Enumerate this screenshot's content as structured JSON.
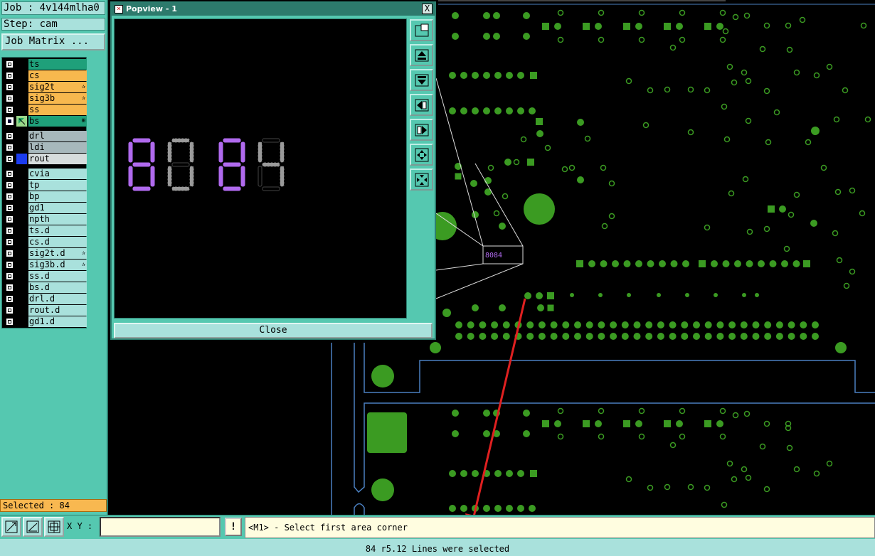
{
  "left_panel": {
    "job_line": "Job : 4v144mlha0",
    "step_line": "Step: cam",
    "job_matrix_button": "Job Matrix ...",
    "selected_status": "Selected : 84",
    "layers": [
      {
        "name": "ts",
        "color": "#1fa07a",
        "mark": ""
      },
      {
        "name": "cs",
        "color": "#f7b84e",
        "mark": ""
      },
      {
        "name": "sig2t",
        "color": "#f7b84e",
        "mark": "✰"
      },
      {
        "name": "sig3b",
        "color": "#f7b84e",
        "mark": "✰"
      },
      {
        "name": "ss",
        "color": "#f7b84e",
        "mark": ""
      },
      {
        "name": "bs",
        "color": "#1fa07a",
        "mark": "⊞"
      },
      {
        "name": "drl",
        "color": "#a7b8bc",
        "mark": ""
      },
      {
        "name": "ldi",
        "color": "#a7b8bc",
        "mark": ""
      },
      {
        "name": "rout",
        "color": "#d6dcdc",
        "mark": ""
      },
      {
        "name": "cvia",
        "color": "#a9e1dc",
        "mark": ""
      },
      {
        "name": "tp",
        "color": "#a9e1dc",
        "mark": ""
      },
      {
        "name": "bp",
        "color": "#a9e1dc",
        "mark": ""
      },
      {
        "name": "gd1",
        "color": "#a9e1dc",
        "mark": ""
      },
      {
        "name": "npth",
        "color": "#a9e1dc",
        "mark": ""
      },
      {
        "name": "ts.d",
        "color": "#a9e1dc",
        "mark": ""
      },
      {
        "name": "cs.d",
        "color": "#a9e1dc",
        "mark": ""
      },
      {
        "name": "sig2t.d",
        "color": "#a9e1dc",
        "mark": "✰"
      },
      {
        "name": "sig3b.d",
        "color": "#a9e1dc",
        "mark": "✰"
      },
      {
        "name": "ss.d",
        "color": "#a9e1dc",
        "mark": ""
      },
      {
        "name": "bs.d",
        "color": "#a9e1dc",
        "mark": ""
      },
      {
        "name": "drl.d",
        "color": "#a9e1dc",
        "mark": ""
      },
      {
        "name": "rout.d",
        "color": "#a9e1dc",
        "mark": ""
      },
      {
        "name": "gd1.d",
        "color": "#a9e1dc",
        "mark": ""
      }
    ]
  },
  "popview": {
    "title": "Popview - 1",
    "close_label": "Close",
    "close_x": "X",
    "digits": "8084",
    "mini_label": "8084",
    "toolbar_icons": [
      "window-fit-icon",
      "layer-up-icon",
      "layer-down-icon",
      "pan-left-icon",
      "pan-right-icon",
      "zoom-in-icon",
      "zoom-out-icon"
    ]
  },
  "bottom_bar": {
    "xy_label": "X Y :",
    "xy_value": "",
    "excl_label": "!",
    "prompt": "<M1> - Select first area corner"
  },
  "status_bar": {
    "message": "84 r5.12 Lines were selected"
  },
  "colors": {
    "pad": "#3b9b22",
    "trace_outline": "#4a7fc0",
    "selection_arrow": "#e02020",
    "digit_highlight": "#b06aee",
    "digit_dim": "#9a9a9a"
  }
}
